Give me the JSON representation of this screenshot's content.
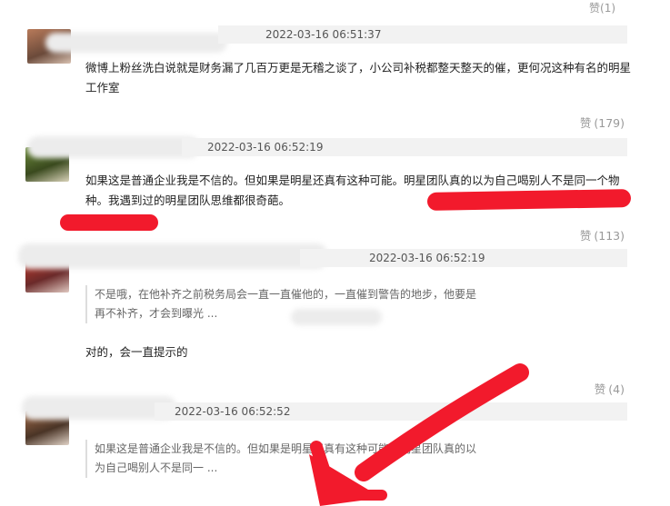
{
  "top_like": {
    "icon": "like-icon",
    "label": "赞",
    "count": "(1)"
  },
  "comments": [
    {
      "timestamp": "2022-03-16 06:51:37",
      "text": "微博上粉丝洗白说就是财务漏了几百万更是无稽之谈了，小公司补税都整天整天的催，更何况这种有名的明星工作室",
      "like_label": "赞",
      "like_count": "(179)"
    },
    {
      "timestamp": "2022-03-16 06:52:19",
      "text": "如果这是普通企业我是不信的。但如果是明星还真有这种可能。明星团队真的以为自己喝别人不是同一个物种。我遇到过的明星团队思维都很奇葩。",
      "like_label": "赞",
      "like_count": "(113)"
    },
    {
      "timestamp": "2022-03-16 06:52:19",
      "quote": "不是哦，在他补齐之前税务局会一直一直催他的，一直催到警告的地步，他要是再不补齐，才会到曝光 ...",
      "text": "对的，会一直提示的",
      "like_label": "赞",
      "like_count": "(4)"
    },
    {
      "timestamp": "2022-03-16 06:52:52",
      "quote": "如果这是普通企业我是不信的。但如果是明星还真有这种可能。明星团队真的以为自己喝别人不是同一 ..."
    }
  ],
  "colors": {
    "annotation": "#f21a2c",
    "meta": "#999999"
  }
}
